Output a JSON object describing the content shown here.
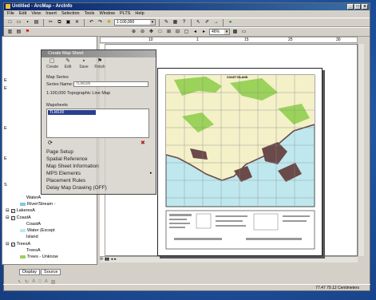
{
  "window": {
    "title": "Untitled - ArcMap - ArcInfo",
    "controls": [
      "_",
      "□",
      "x"
    ]
  },
  "menu": [
    "File",
    "Edit",
    "View",
    "Insert",
    "Selection",
    "Tools",
    "Window",
    "PLTS",
    "Help"
  ],
  "toolbar": {
    "scale_value": "1:100,000",
    "zoom_value": "46%"
  },
  "toc": {
    "tabs": [
      "Display",
      "Source"
    ],
    "rows": [
      {
        "label": "WaterA",
        "checked": false
      },
      {
        "label": "River/Stream -",
        "checked": false
      },
      {
        "label": "LakeresA",
        "checked": true
      },
      {
        "label": "CoastA",
        "checked": true
      },
      {
        "label": "CoastA",
        "checked": false
      },
      {
        "label": "Water (Except",
        "checked": false
      },
      {
        "label": "Island",
        "checked": false
      },
      {
        "label": "TreesA",
        "checked": true
      },
      {
        "label": "TreesA",
        "checked": false
      },
      {
        "label": "Trees - Unknow",
        "checked": false
      }
    ],
    "partial_letters": [
      "E",
      "E",
      "E",
      "E",
      "S"
    ]
  },
  "dialog": {
    "title": "Create Map Sheet",
    "tools": [
      "Create",
      "Edit",
      "Save",
      "Finish"
    ],
    "map_series_label": "Map Series",
    "series_name_label": "Series Name:",
    "series_name_value": "TLM100",
    "series_description": "1:100,000 Topographic Line Map",
    "mapsheets_label": "Mapsheets",
    "mapsheet_selected": "TLM100",
    "menu": [
      "Page Setup",
      "Spatial Reference",
      "Map Sheet Information",
      "MPS Elements",
      "Placement Rules",
      "Delay Map Drawing (OFF)"
    ]
  },
  "ruler": {
    "ticks": [
      "10",
      "1",
      "15",
      "25",
      "30"
    ]
  },
  "map_title": "COAST ISLAND",
  "status": {
    "coordinates": "77.47  79.12 Centimeters"
  },
  "colors": {
    "land": "#f4f0c8",
    "water": "#bfe8ee",
    "vegetation": "#9ad25a",
    "urban": "#6b4a4a",
    "desktop": "#1d4f9c"
  }
}
